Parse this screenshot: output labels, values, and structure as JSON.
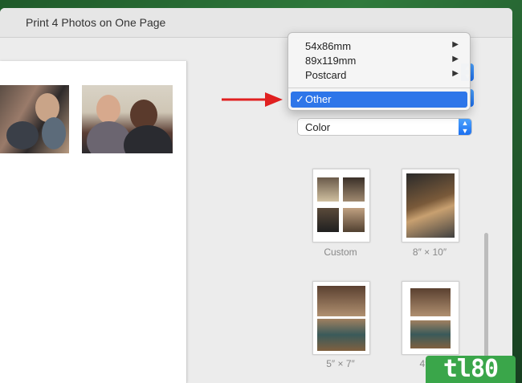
{
  "window": {
    "title": "Print 4 Photos on One Page"
  },
  "menu": {
    "items": [
      {
        "label": "54x86mm",
        "has_submenu": true
      },
      {
        "label": "89x119mm",
        "has_submenu": true
      },
      {
        "label": "Postcard",
        "has_submenu": true
      }
    ],
    "selected": {
      "label": "Other",
      "check": "✓"
    }
  },
  "color_popup": {
    "value": "Color"
  },
  "thumbnails": [
    {
      "label": "Custom"
    },
    {
      "label": "8″ × 10″"
    },
    {
      "label": "5″ × 7″"
    },
    {
      "label": "4″"
    }
  ],
  "watermark": {
    "text": "tl80"
  },
  "colors": {
    "accent": "#2e76e9",
    "annotation_arrow": "#e02020",
    "logo": "#3aa64a"
  }
}
